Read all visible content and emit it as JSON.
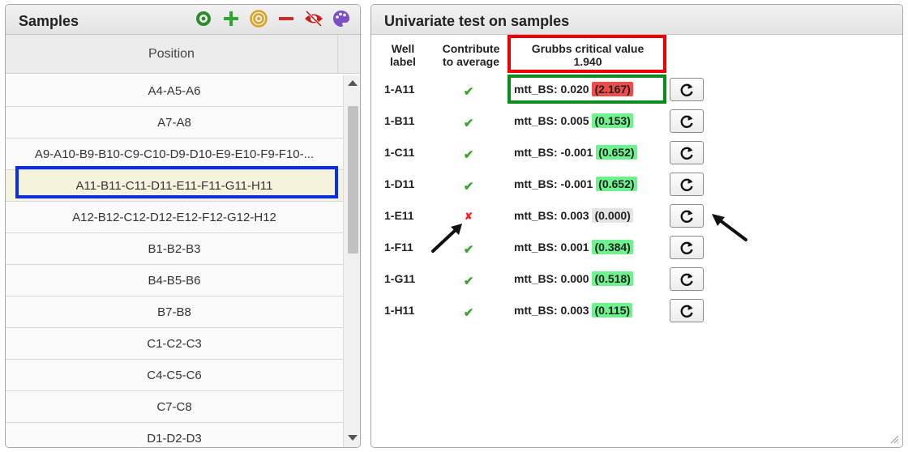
{
  "samples_panel": {
    "title": "Samples",
    "column_header": "Position",
    "toolbar_icons": [
      "eye-icon",
      "plus-icon",
      "target-icon",
      "minus-icon",
      "eye-off-icon",
      "palette-icon"
    ],
    "rows": [
      {
        "label": "A4-A5-A6"
      },
      {
        "label": "A7-A8"
      },
      {
        "label": "A9-A10-B9-B10-C9-C10-D9-D10-E9-E10-F9-F10-..."
      },
      {
        "label": "A11-B11-C11-D11-E11-F11-G11-H11",
        "selected": true
      },
      {
        "label": "A12-B12-C12-D12-E12-F12-G12-H12"
      },
      {
        "label": "B1-B2-B3"
      },
      {
        "label": "B4-B5-B6"
      },
      {
        "label": "B7-B8"
      },
      {
        "label": "C1-C2-C3"
      },
      {
        "label": "C4-C5-C6"
      },
      {
        "label": "C7-C8"
      },
      {
        "label": "D1-D2-D3"
      }
    ]
  },
  "test_panel": {
    "title": "Univariate test on samples",
    "headers": {
      "well_line1": "Well",
      "well_line2": "label",
      "contrib_line1": "Contribute",
      "contrib_line2": "to average",
      "grubbs_line1": "Grubbs critical value",
      "grubbs_value": "1.940"
    },
    "rows": [
      {
        "well": "1-A11",
        "contributes": true,
        "measure": "mtt_BS: 0.020",
        "score": "(2.167)",
        "score_status": "red"
      },
      {
        "well": "1-B11",
        "contributes": true,
        "measure": "mtt_BS: 0.005",
        "score": "(0.153)",
        "score_status": "green"
      },
      {
        "well": "1-C11",
        "contributes": true,
        "measure": "mtt_BS: -0.001",
        "score": "(0.652)",
        "score_status": "green"
      },
      {
        "well": "1-D11",
        "contributes": true,
        "measure": "mtt_BS: -0.001",
        "score": "(0.652)",
        "score_status": "green"
      },
      {
        "well": "1-E11",
        "contributes": false,
        "measure": "mtt_BS: 0.003",
        "score": "(0.000)",
        "score_status": "gray"
      },
      {
        "well": "1-F11",
        "contributes": true,
        "measure": "mtt_BS: 0.001",
        "score": "(0.384)",
        "score_status": "green"
      },
      {
        "well": "1-G11",
        "contributes": true,
        "measure": "mtt_BS: 0.000",
        "score": "(0.518)",
        "score_status": "green"
      },
      {
        "well": "1-H11",
        "contributes": true,
        "measure": "mtt_BS: 0.003",
        "score": "(0.115)",
        "score_status": "green"
      }
    ],
    "check_glyph": "✔",
    "cross_glyph": "✘"
  },
  "colors": {
    "green_score": "#6df28e",
    "red_score": "#ef4b4b",
    "gray_score": "#e4e4e4",
    "check_green": "#3aa72c",
    "cross_red": "#ff1f1f",
    "highlight_blue": "#0a2bf0",
    "highlight_red": "#ee0000",
    "highlight_green": "#0b8a1e"
  }
}
